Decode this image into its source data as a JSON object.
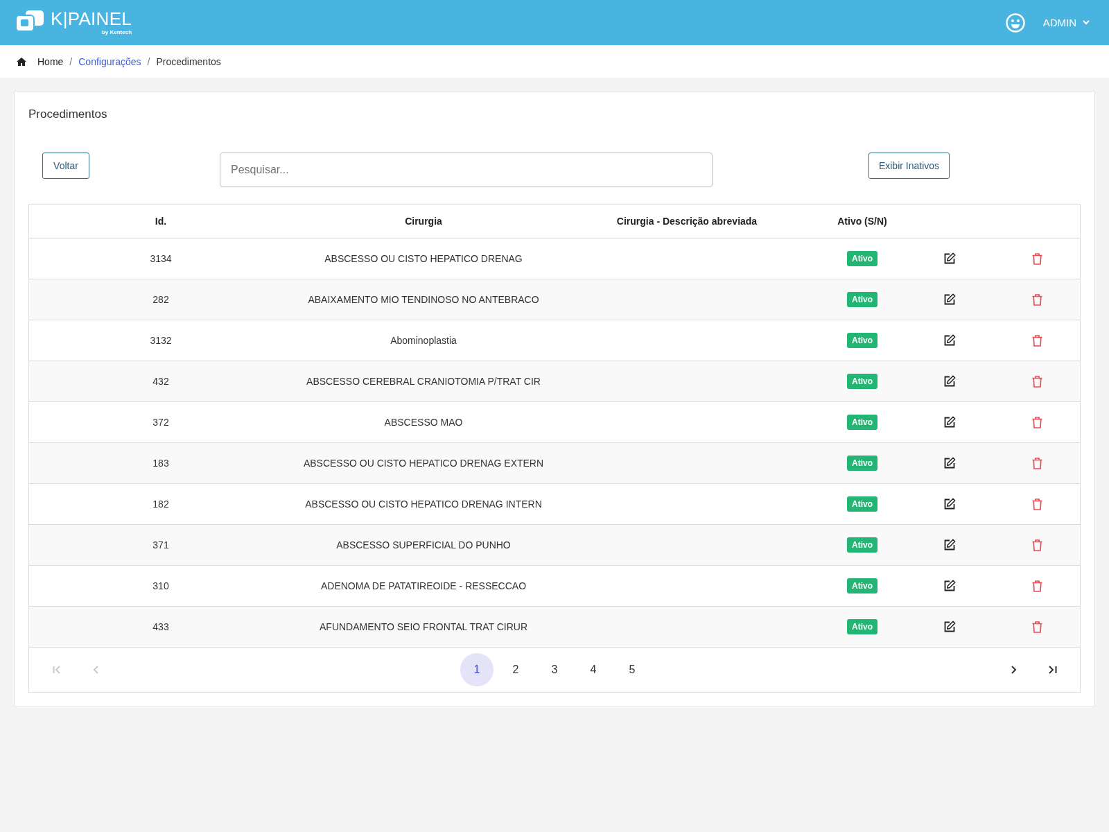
{
  "header": {
    "logo": {
      "wordmark": "K|PAINEL",
      "byline": "by Kentech"
    },
    "user": {
      "name": "ADMIN"
    }
  },
  "breadcrumb": [
    {
      "label": "Home",
      "kind": "home"
    },
    {
      "label": "Configurações",
      "kind": "link",
      "separator": "/"
    },
    {
      "label": "Procedimentos",
      "kind": "current",
      "separator": "/"
    }
  ],
  "page": {
    "title": "Procedimentos",
    "back_button": "Voltar",
    "search": {
      "placeholder": "Pesquisar..."
    },
    "show_inactive_button": "Exibir Inativos"
  },
  "table": {
    "columns": [
      "Id.",
      "Cirurgia",
      "Cirurgia - Descrição abreviada",
      "Ativo (S/N)"
    ],
    "rows": [
      {
        "id": "3134",
        "cirurgia": "ABSCESSO OU CISTO HEPATICO DRENAG",
        "status": {
          "label": "Ativo",
          "active": true
        }
      },
      {
        "id": "282",
        "cirurgia": "ABAIXAMENTO MIO TENDINOSO NO ANTEBRACO",
        "status": {
          "label": "Ativo",
          "active": true
        }
      },
      {
        "id": "3132",
        "cirurgia": "Abominoplastia",
        "status": {
          "label": "Ativo",
          "active": true
        }
      },
      {
        "id": "432",
        "cirurgia": "ABSCESSO CEREBRAL CRANIOTOMIA P/TRAT CIR",
        "status": {
          "label": "Ativo",
          "active": true
        }
      },
      {
        "id": "372",
        "cirurgia": "ABSCESSO MAO",
        "status": {
          "label": "Ativo",
          "active": true
        }
      },
      {
        "id": "183",
        "cirurgia": "ABSCESSO OU CISTO HEPATICO DRENAG EXTERN",
        "status": {
          "label": "Ativo",
          "active": true
        }
      },
      {
        "id": "182",
        "cirurgia": "ABSCESSO OU CISTO HEPATICO DRENAG INTERN",
        "status": {
          "label": "Ativo",
          "active": true
        }
      },
      {
        "id": "371",
        "cirurgia": "ABSCESSO SUPERFICIAL DO PUNHO",
        "status": {
          "label": "Ativo",
          "active": true
        }
      },
      {
        "id": "310",
        "cirurgia": "ADENOMA DE PATATIREOIDE - RESSECCAO",
        "status": {
          "label": "Ativo",
          "active": true
        }
      },
      {
        "id": "433",
        "cirurgia": "AFUNDAMENTO SEIO FRONTAL TRAT CIRUR",
        "status": {
          "label": "Ativo",
          "active": true
        }
      }
    ]
  },
  "pagination": {
    "first": {
      "disabled": true
    },
    "previous": {
      "disabled": true
    },
    "pages": [
      {
        "label": "1",
        "selected": true
      },
      {
        "label": "2",
        "selected": false
      },
      {
        "label": "3",
        "selected": false
      },
      {
        "label": "4",
        "selected": false
      },
      {
        "label": "5",
        "selected": false
      }
    ],
    "next": {
      "disabled": false
    },
    "last": {
      "disabled": false
    }
  }
}
